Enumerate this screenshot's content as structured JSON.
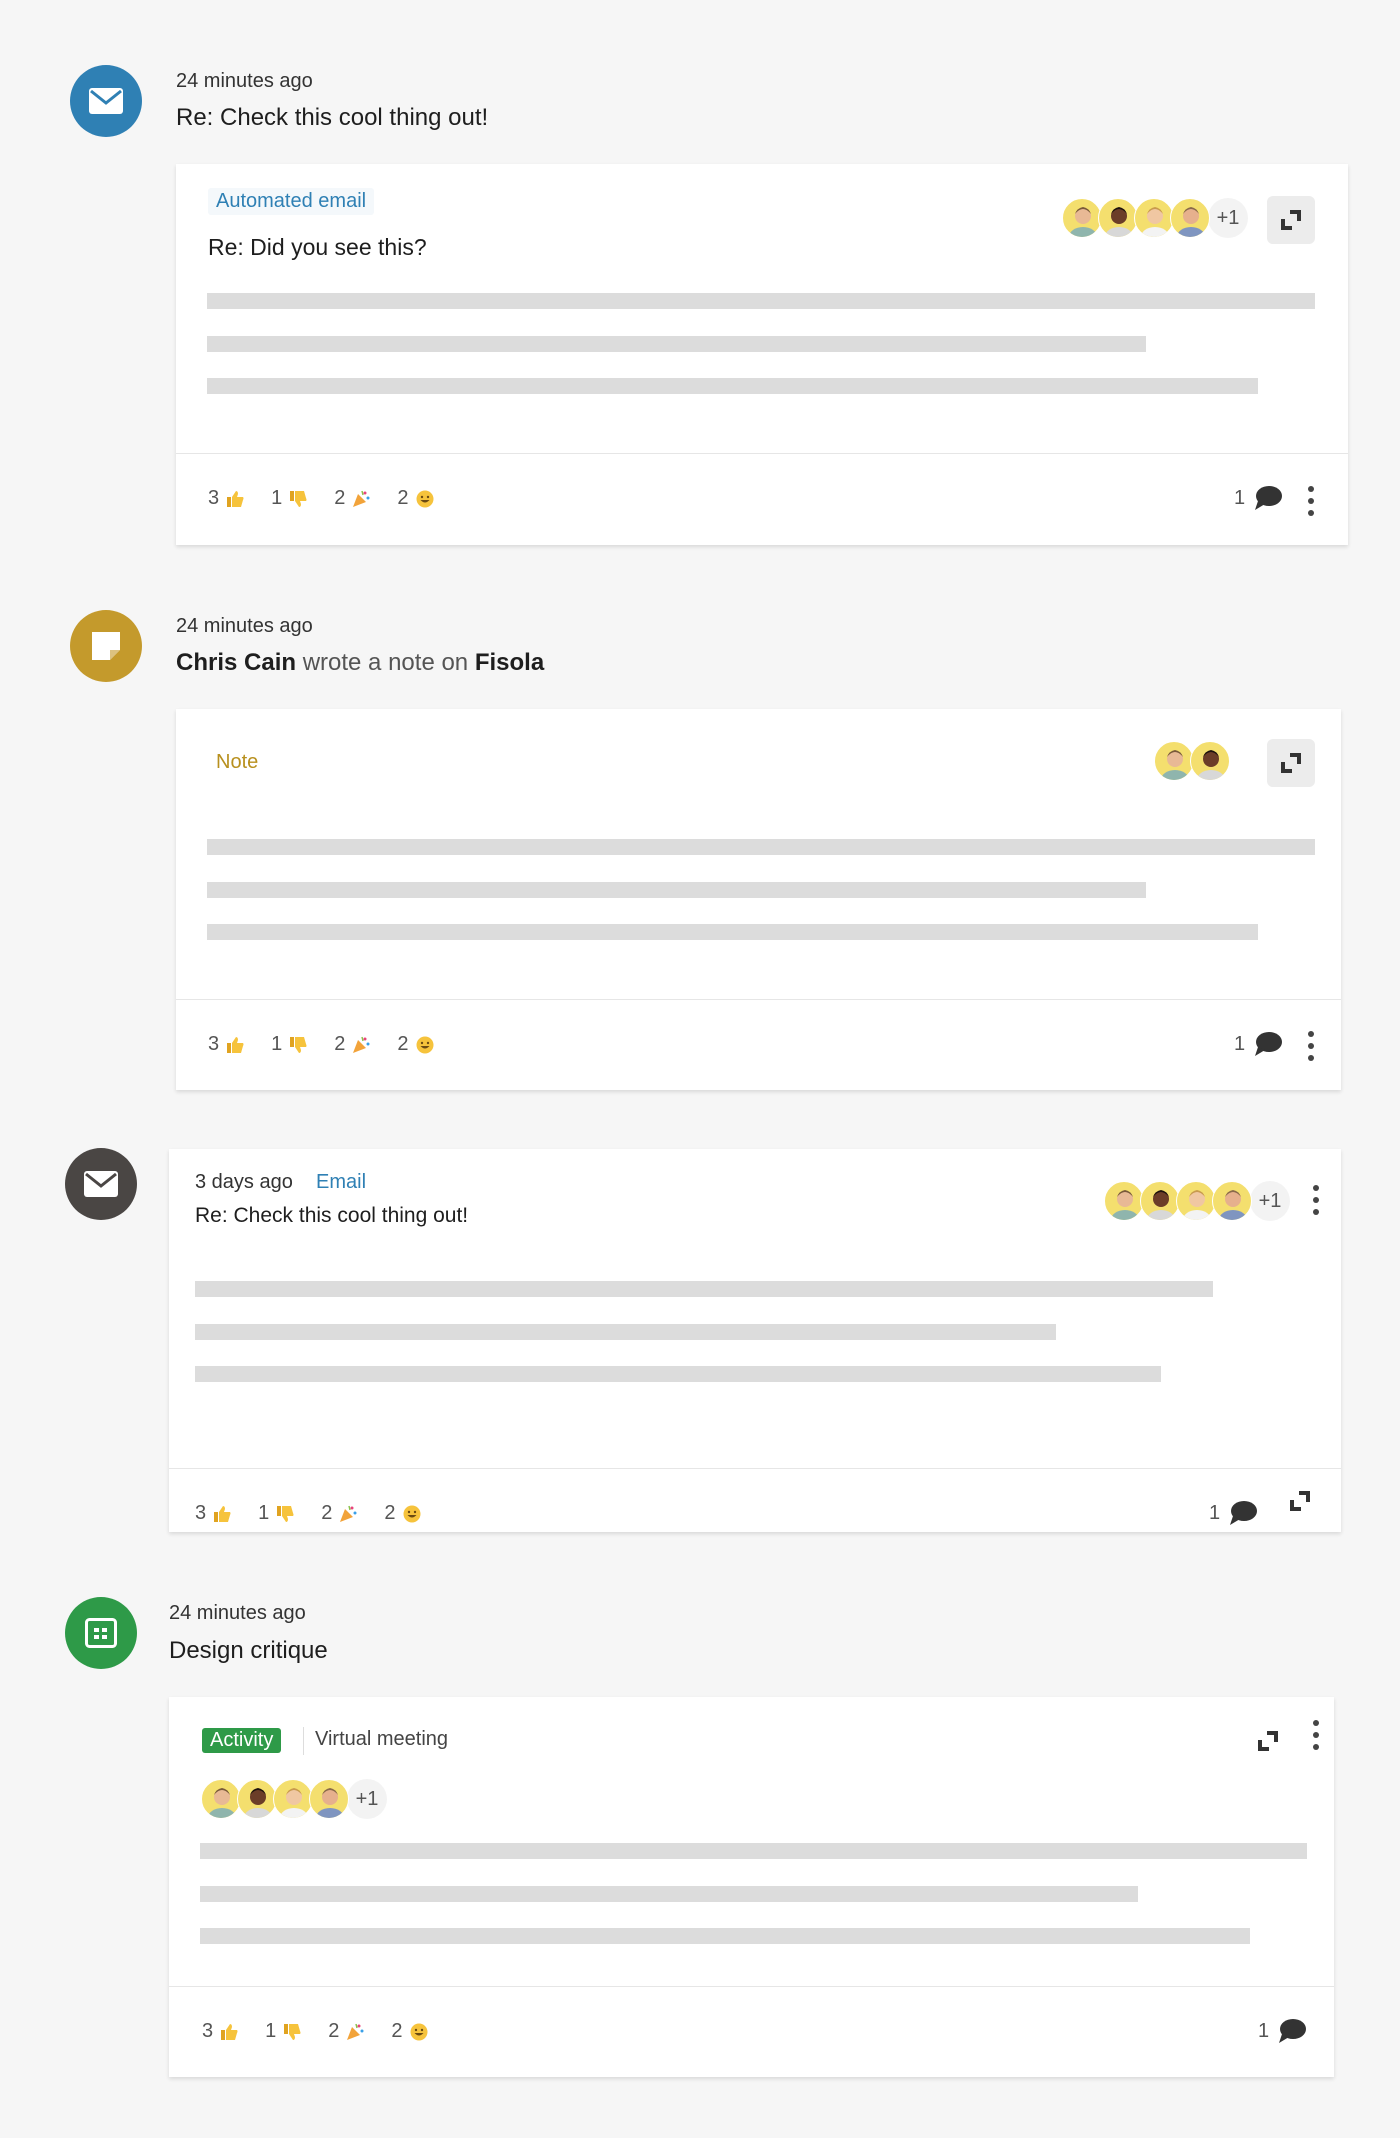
{
  "feed": [
    {
      "icon": "envelope-icon",
      "icon_color": "#2f80b4",
      "timestamp": "24 minutes ago",
      "title": "Re: Check this cool thing out!",
      "card": {
        "tag": "Automated email",
        "tag_color": "#2f80b4",
        "subtitle": "Re: Did you see this?",
        "participants_more": "+1",
        "reactions": [
          {
            "count": "3",
            "emoji": "thumbs-up"
          },
          {
            "count": "1",
            "emoji": "thumbs-down"
          },
          {
            "count": "2",
            "emoji": "party-popper"
          },
          {
            "count": "2",
            "emoji": "grinning-face"
          }
        ],
        "comments": "1"
      }
    },
    {
      "icon": "note-icon",
      "icon_color": "#c49a2c",
      "timestamp": "24 minutes ago",
      "title_parts": {
        "author": "Chris Cain",
        "verb": "wrote a note on",
        "target": "Fisola"
      },
      "card": {
        "tag": "Note",
        "tag_color": "#b8901e",
        "reactions": [
          {
            "count": "3",
            "emoji": "thumbs-up"
          },
          {
            "count": "1",
            "emoji": "thumbs-down"
          },
          {
            "count": "2",
            "emoji": "party-popper"
          },
          {
            "count": "2",
            "emoji": "grinning-face"
          }
        ],
        "comments": "1"
      }
    },
    {
      "icon": "envelope-icon",
      "icon_color": "#4a4644",
      "card": {
        "timestamp": "3 days ago",
        "tag": "Email",
        "tag_color": "#2f80b4",
        "subtitle": "Re: Check this cool thing out!",
        "participants_more": "+1",
        "reactions": [
          {
            "count": "3",
            "emoji": "thumbs-up"
          },
          {
            "count": "1",
            "emoji": "thumbs-down"
          },
          {
            "count": "2",
            "emoji": "party-popper"
          },
          {
            "count": "2",
            "emoji": "grinning-face"
          }
        ],
        "comments": "1"
      }
    },
    {
      "icon": "calendar-icon",
      "icon_color": "#2e9a48",
      "timestamp": "24 minutes ago",
      "title": "Design critique",
      "card": {
        "tag": "Activity",
        "tag_color": "#2e9a48",
        "meeting_type": "Virtual meeting",
        "participants_more": "+1",
        "reactions": [
          {
            "count": "3",
            "emoji": "thumbs-up"
          },
          {
            "count": "1",
            "emoji": "thumbs-down"
          },
          {
            "count": "2",
            "emoji": "party-popper"
          },
          {
            "count": "2",
            "emoji": "grinning-face"
          }
        ],
        "comments": "1"
      }
    }
  ]
}
